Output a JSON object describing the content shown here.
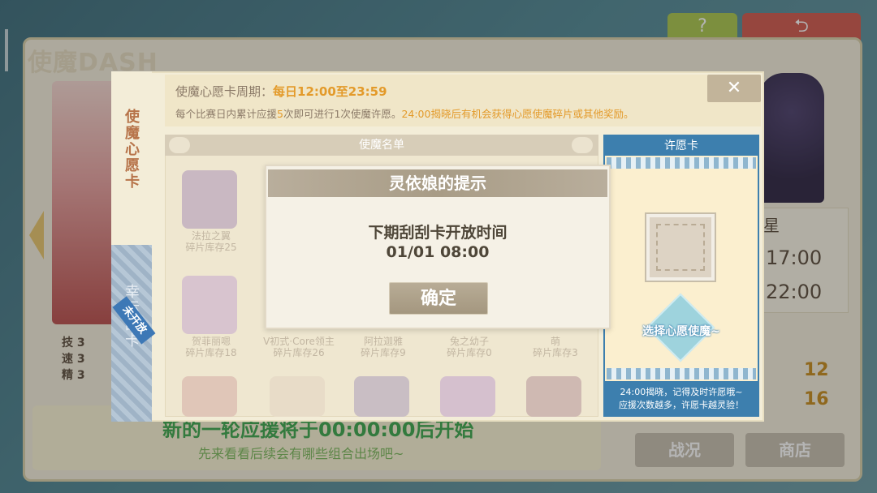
{
  "background": {
    "title": "使魔DASH",
    "stats": [
      "技 3",
      "速 3",
      "精 3"
    ],
    "next_round_text": "新的一轮应援将于00:00:00后开始",
    "next_round_sub": "先来看看后续会有哪些组合出场吧~",
    "right_label": "星",
    "times": [
      "17:00",
      "22:00"
    ],
    "numbers": [
      "12",
      "16"
    ],
    "buttons": {
      "battle": "战况",
      "shop": "商店"
    },
    "help_label": "?",
    "back_label": "⮌"
  },
  "popup": {
    "side_tabs": {
      "wish_card": "使魔心愿卡",
      "scratch_card": "幸运刮卡"
    },
    "ribbon": "未开放",
    "info": {
      "line1_prefix": "使魔心愿卡周期：",
      "line1_value": "每日12:00至23:59",
      "line2_a": "每个比赛日内累计应援",
      "line2_num": "5",
      "line2_b": "次即可进行1次使魔许愿。",
      "line2_hl": "24:00揭晓后有机会获得心愿使魔碎片或其他奖励。"
    },
    "close_label": "✕",
    "list_title": "使魔名单",
    "items": [
      {
        "label": "法拉之翼\n碎片库存25"
      },
      {
        "label": ""
      },
      {
        "label": "贺菲丽嗯\n碎片库存18"
      },
      {
        "label": "V初式·Core领主\n碎片库存26"
      },
      {
        "label": "阿拉迦雅\n碎片库存9"
      },
      {
        "label": "兔之幼子\n碎片库存0"
      },
      {
        "label": "萌\n碎片库存3"
      }
    ],
    "wish": {
      "title": "许愿卡",
      "select_label": "选择心愿使魔~",
      "footer_line1": "24:00揭晓，记得及时许愿哦~",
      "footer_line2": "应援次数越多，许愿卡越灵验！"
    }
  },
  "dialog": {
    "title": "灵依娘的提示",
    "message": "下期刮刮卡开放时间",
    "time": "01/01 08:00",
    "confirm": "确定"
  }
}
